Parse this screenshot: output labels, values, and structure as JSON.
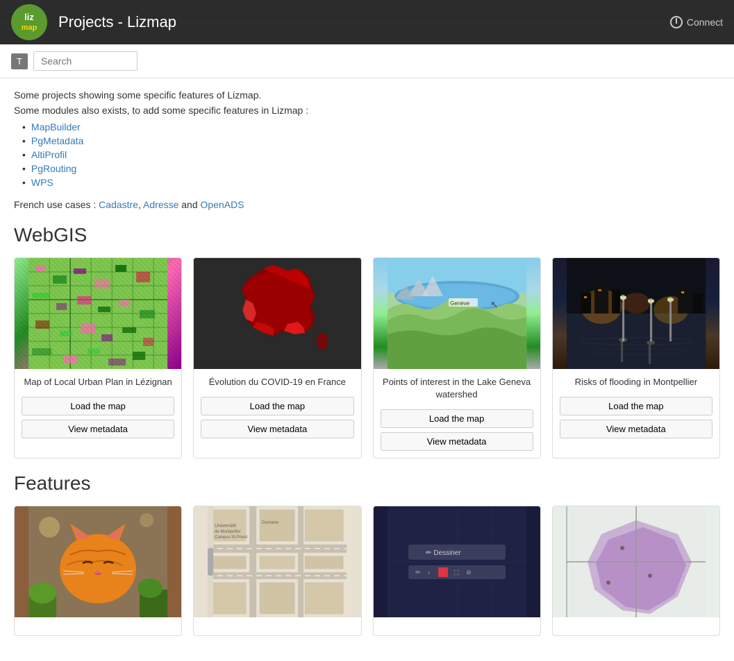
{
  "header": {
    "logo_text": "liz",
    "logo_sub": "map",
    "title": "Projects - Lizmap",
    "connect_label": "Connect"
  },
  "search": {
    "t_label": "T",
    "placeholder": "Search"
  },
  "intro": {
    "line1": "Some projects showing some specific features of Lizmap.",
    "line2": "Some modules also exists, to add some specific features in Lizmap :",
    "modules": [
      {
        "label": "MapBuilder",
        "href": "#"
      },
      {
        "label": "PgMetadata",
        "href": "#"
      },
      {
        "label": "AltiProfil",
        "href": "#"
      },
      {
        "label": "PgRouting",
        "href": "#"
      },
      {
        "label": "WPS",
        "href": "#"
      }
    ],
    "french_prefix": "French use cases : ",
    "french_links": [
      {
        "label": "Cadastre",
        "href": "#"
      },
      {
        "label": "Adresse",
        "href": "#"
      },
      {
        "label": "OpenADS",
        "href": "#"
      }
    ],
    "french_and": " and "
  },
  "webgis": {
    "section_title": "WebGIS",
    "cards": [
      {
        "id": "lezignan",
        "title": "Map of Local Urban Plan in Lézignan",
        "load_label": "Load the map",
        "metadata_label": "View metadata"
      },
      {
        "id": "covid",
        "title": "Évolution du COVID-19 en France",
        "load_label": "Load the map",
        "metadata_label": "View metadata"
      },
      {
        "id": "geneva",
        "title": "Points of interest in the Lake Geneva watershed",
        "load_label": "Load the map",
        "metadata_label": "View metadata"
      },
      {
        "id": "flooding",
        "title": "Risks of flooding in Montpellier",
        "load_label": "Load the map",
        "metadata_label": "View metadata"
      }
    ]
  },
  "features": {
    "section_title": "Features",
    "cards": [
      {
        "id": "cat",
        "title": ""
      },
      {
        "id": "street",
        "title": ""
      },
      {
        "id": "drawing",
        "title": "",
        "toolbar_label": "Dessiner"
      },
      {
        "id": "purple",
        "title": ""
      }
    ]
  }
}
